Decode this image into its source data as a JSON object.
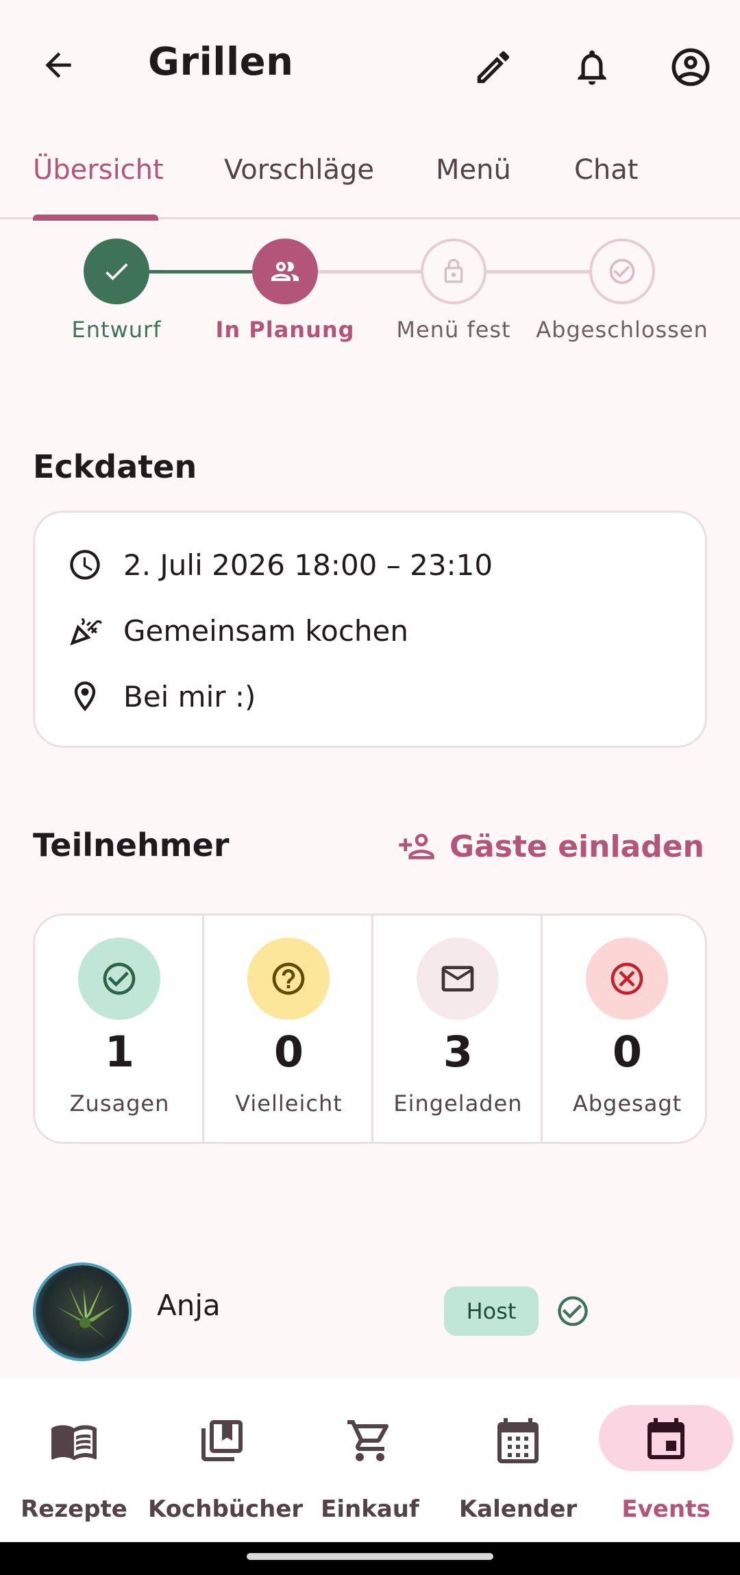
{
  "header": {
    "title": "Grillen"
  },
  "tabs": [
    {
      "label": "Übersicht",
      "active": true
    },
    {
      "label": "Vorschläge",
      "active": false
    },
    {
      "label": "Menü",
      "active": false
    },
    {
      "label": "Chat",
      "active": false
    }
  ],
  "stepper": {
    "steps": [
      {
        "label": "Entwurf",
        "state": "done"
      },
      {
        "label": "In Planung",
        "state": "current"
      },
      {
        "label": "Menü fest",
        "state": "locked"
      },
      {
        "label": "Abgeschlossen",
        "state": "pending"
      }
    ]
  },
  "eckdaten": {
    "title": "Eckdaten",
    "datetime": "2. Juli 2026 18:00 – 23:10",
    "type": "Gemeinsam kochen",
    "location": "Bei mir :)"
  },
  "participants": {
    "title": "Teilnehmer",
    "invite_label": "Gäste einladen",
    "stats": [
      {
        "value": "1",
        "label": "Zusagen",
        "icon": "check-circle-icon"
      },
      {
        "value": "0",
        "label": "Vielleicht",
        "icon": "help-circle-icon"
      },
      {
        "value": "3",
        "label": "Eingeladen",
        "icon": "mail-icon"
      },
      {
        "value": "0",
        "label": "Abgesagt",
        "icon": "cancel-circle-icon"
      }
    ],
    "list": [
      {
        "name": "Anja",
        "role": "Host",
        "status": "accepted"
      }
    ]
  },
  "bottom_nav": [
    {
      "label": "Rezepte",
      "icon": "book-icon",
      "active": false
    },
    {
      "label": "Kochbücher",
      "icon": "library-icon",
      "active": false
    },
    {
      "label": "Einkauf",
      "icon": "cart-icon",
      "active": false
    },
    {
      "label": "Kalender",
      "icon": "calendar-icon",
      "active": false
    },
    {
      "label": "Events",
      "icon": "event-icon",
      "active": true
    }
  ],
  "colors": {
    "accent": "#b35578",
    "done_green": "#3e7358",
    "background": "#fdf7f8"
  }
}
